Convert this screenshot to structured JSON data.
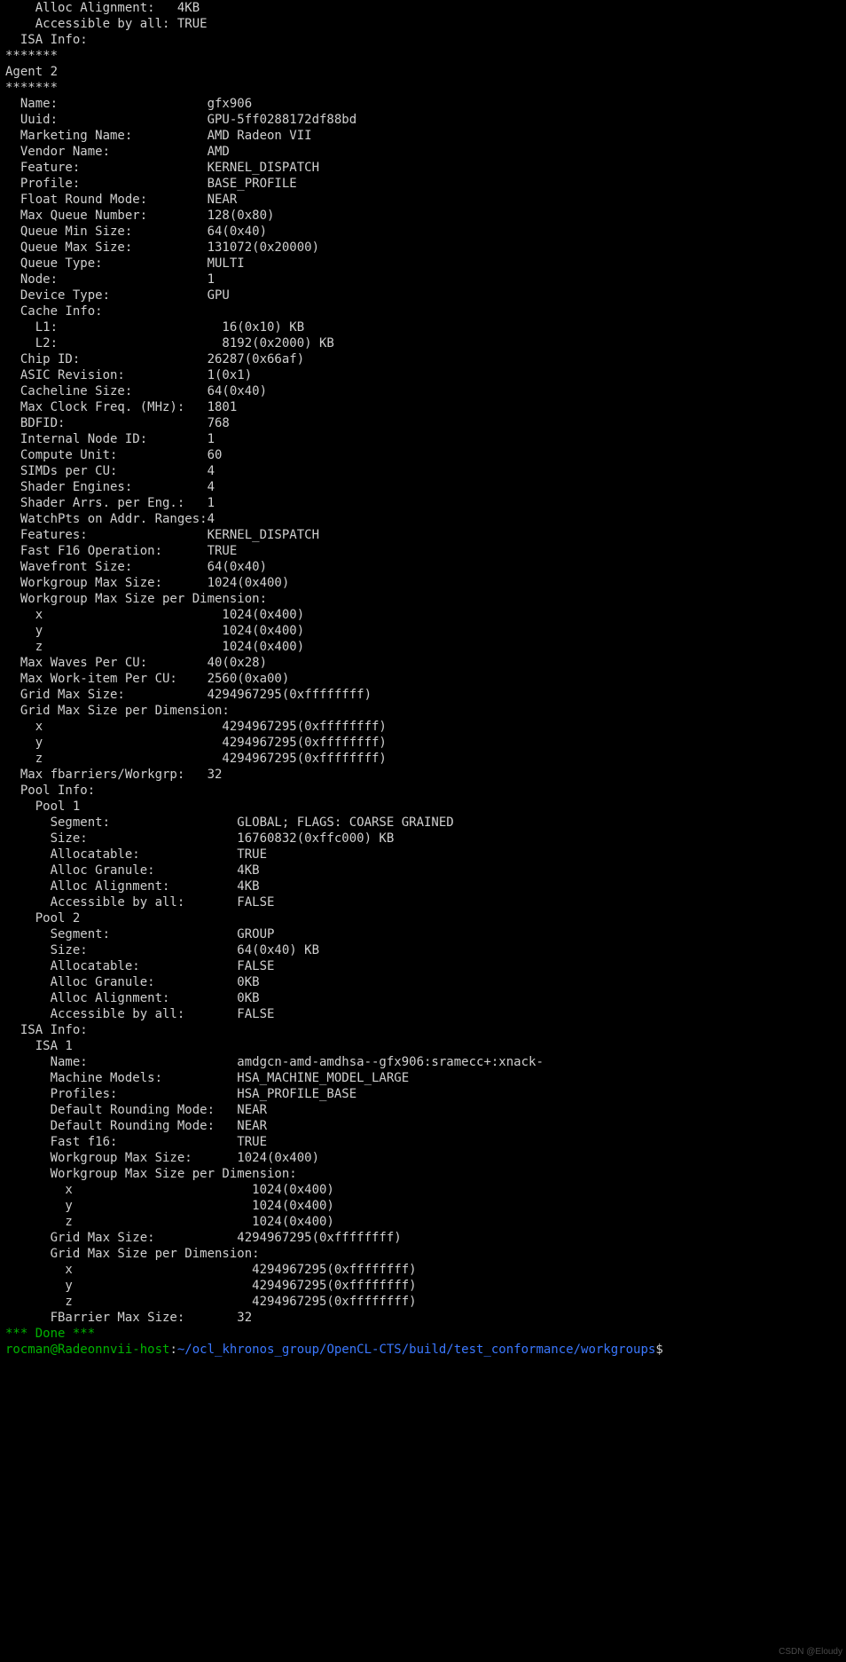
{
  "top": {
    "alloc_alignment_label": "    Alloc Alignment:   ",
    "alloc_alignment_value": "4KB",
    "accessible_label": "    Accessible by all: ",
    "accessible_value": "TRUE",
    "isa_info_label": "  ISA Info:",
    "sep": "*******"
  },
  "agent": {
    "header": "Agent 2",
    "sep": "*******",
    "props": [
      {
        "l": "  Name:                    ",
        "v": "gfx906"
      },
      {
        "l": "  Uuid:                    ",
        "v": "GPU-5ff0288172df88bd"
      },
      {
        "l": "  Marketing Name:          ",
        "v": "AMD Radeon VII"
      },
      {
        "l": "  Vendor Name:             ",
        "v": "AMD"
      },
      {
        "l": "  Feature:                 ",
        "v": "KERNEL_DISPATCH"
      },
      {
        "l": "  Profile:                 ",
        "v": "BASE_PROFILE"
      },
      {
        "l": "  Float Round Mode:        ",
        "v": "NEAR"
      },
      {
        "l": "  Max Queue Number:        ",
        "v": "128(0x80)"
      },
      {
        "l": "  Queue Min Size:          ",
        "v": "64(0x40)"
      },
      {
        "l": "  Queue Max Size:          ",
        "v": "131072(0x20000)"
      },
      {
        "l": "  Queue Type:              ",
        "v": "MULTI"
      },
      {
        "l": "  Node:                    ",
        "v": "1"
      },
      {
        "l": "  Device Type:             ",
        "v": "GPU"
      }
    ],
    "cache_info_label": "  Cache Info:",
    "cache": [
      {
        "l": "    L1:                      ",
        "v": "16(0x10) KB"
      },
      {
        "l": "    L2:                      ",
        "v": "8192(0x2000) KB"
      }
    ],
    "props2": [
      {
        "l": "  Chip ID:                 ",
        "v": "26287(0x66af)"
      },
      {
        "l": "  ASIC Revision:           ",
        "v": "1(0x1)"
      },
      {
        "l": "  Cacheline Size:          ",
        "v": "64(0x40)"
      },
      {
        "l": "  Max Clock Freq. (MHz):   ",
        "v": "1801"
      },
      {
        "l": "  BDFID:                   ",
        "v": "768"
      },
      {
        "l": "  Internal Node ID:        ",
        "v": "1"
      },
      {
        "l": "  Compute Unit:            ",
        "v": "60"
      },
      {
        "l": "  SIMDs per CU:            ",
        "v": "4"
      },
      {
        "l": "  Shader Engines:          ",
        "v": "4"
      },
      {
        "l": "  Shader Arrs. per Eng.:   ",
        "v": "1"
      },
      {
        "l": "  WatchPts on Addr. Ranges:",
        "v": "4"
      },
      {
        "l": "  Features:                ",
        "v": "KERNEL_DISPATCH"
      },
      {
        "l": "  Fast F16 Operation:      ",
        "v": "TRUE"
      },
      {
        "l": "  Wavefront Size:          ",
        "v": "64(0x40)"
      },
      {
        "l": "  Workgroup Max Size:      ",
        "v": "1024(0x400)"
      }
    ],
    "wg_dim_label": "  Workgroup Max Size per Dimension:",
    "wg_dim": [
      {
        "l": "    x                        ",
        "v": "1024(0x400)"
      },
      {
        "l": "    y                        ",
        "v": "1024(0x400)"
      },
      {
        "l": "    z                        ",
        "v": "1024(0x400)"
      }
    ],
    "props3": [
      {
        "l": "  Max Waves Per CU:        ",
        "v": "40(0x28)"
      },
      {
        "l": "  Max Work-item Per CU:    ",
        "v": "2560(0xa00)"
      },
      {
        "l": "  Grid Max Size:           ",
        "v": "4294967295(0xffffffff)"
      }
    ],
    "grid_dim_label": "  Grid Max Size per Dimension:",
    "grid_dim": [
      {
        "l": "    x                        ",
        "v": "4294967295(0xffffffff)"
      },
      {
        "l": "    y                        ",
        "v": "4294967295(0xffffffff)"
      },
      {
        "l": "    z                        ",
        "v": "4294967295(0xffffffff)"
      }
    ],
    "max_fbarriers": {
      "l": "  Max fbarriers/Workgrp:   ",
      "v": "32"
    }
  },
  "pool": {
    "header": "  Pool Info:",
    "pools": [
      {
        "name": "    Pool 1",
        "props": [
          {
            "l": "      Segment:                 ",
            "v": "GLOBAL; FLAGS: COARSE GRAINED"
          },
          {
            "l": "      Size:                    ",
            "v": "16760832(0xffc000) KB"
          },
          {
            "l": "      Allocatable:             ",
            "v": "TRUE"
          },
          {
            "l": "      Alloc Granule:           ",
            "v": "4KB"
          },
          {
            "l": "      Alloc Alignment:         ",
            "v": "4KB"
          },
          {
            "l": "      Accessible by all:       ",
            "v": "FALSE"
          }
        ]
      },
      {
        "name": "    Pool 2",
        "props": [
          {
            "l": "      Segment:                 ",
            "v": "GROUP"
          },
          {
            "l": "      Size:                    ",
            "v": "64(0x40) KB"
          },
          {
            "l": "      Allocatable:             ",
            "v": "FALSE"
          },
          {
            "l": "      Alloc Granule:           ",
            "v": "0KB"
          },
          {
            "l": "      Alloc Alignment:         ",
            "v": "0KB"
          },
          {
            "l": "      Accessible by all:       ",
            "v": "FALSE"
          }
        ]
      }
    ]
  },
  "isa": {
    "header": "  ISA Info:",
    "name": "    ISA 1",
    "props": [
      {
        "l": "      Name:                    ",
        "v": "amdgcn-amd-amdhsa--gfx906:sramecc+:xnack-"
      },
      {
        "l": "      Machine Models:          ",
        "v": "HSA_MACHINE_MODEL_LARGE"
      },
      {
        "l": "      Profiles:                ",
        "v": "HSA_PROFILE_BASE"
      },
      {
        "l": "      Default Rounding Mode:   ",
        "v": "NEAR"
      },
      {
        "l": "      Default Rounding Mode:   ",
        "v": "NEAR"
      },
      {
        "l": "      Fast f16:                ",
        "v": "TRUE"
      },
      {
        "l": "      Workgroup Max Size:      ",
        "v": "1024(0x400)"
      }
    ],
    "wg_dim_label": "      Workgroup Max Size per Dimension:",
    "wg_dim": [
      {
        "l": "        x                        ",
        "v": "1024(0x400)"
      },
      {
        "l": "        y                        ",
        "v": "1024(0x400)"
      },
      {
        "l": "        z                        ",
        "v": "1024(0x400)"
      }
    ],
    "grid_max": {
      "l": "      Grid Max Size:           ",
      "v": "4294967295(0xffffffff)"
    },
    "grid_dim_label": "      Grid Max Size per Dimension:",
    "grid_dim": [
      {
        "l": "        x                        ",
        "v": "4294967295(0xffffffff)"
      },
      {
        "l": "        y                        ",
        "v": "4294967295(0xffffffff)"
      },
      {
        "l": "        z                        ",
        "v": "4294967295(0xffffffff)"
      }
    ],
    "fbarrier": {
      "l": "      FBarrier Max Size:       ",
      "v": "32"
    }
  },
  "done": "*** Done ***",
  "prompt": {
    "user": "rocman@Radeonnvii-host",
    "colon": ":",
    "path": "~/ocl_khronos_group/OpenCL-CTS/build/test_conformance/workgroups",
    "dollar": "$"
  },
  "watermark": "CSDN @Eloudy"
}
